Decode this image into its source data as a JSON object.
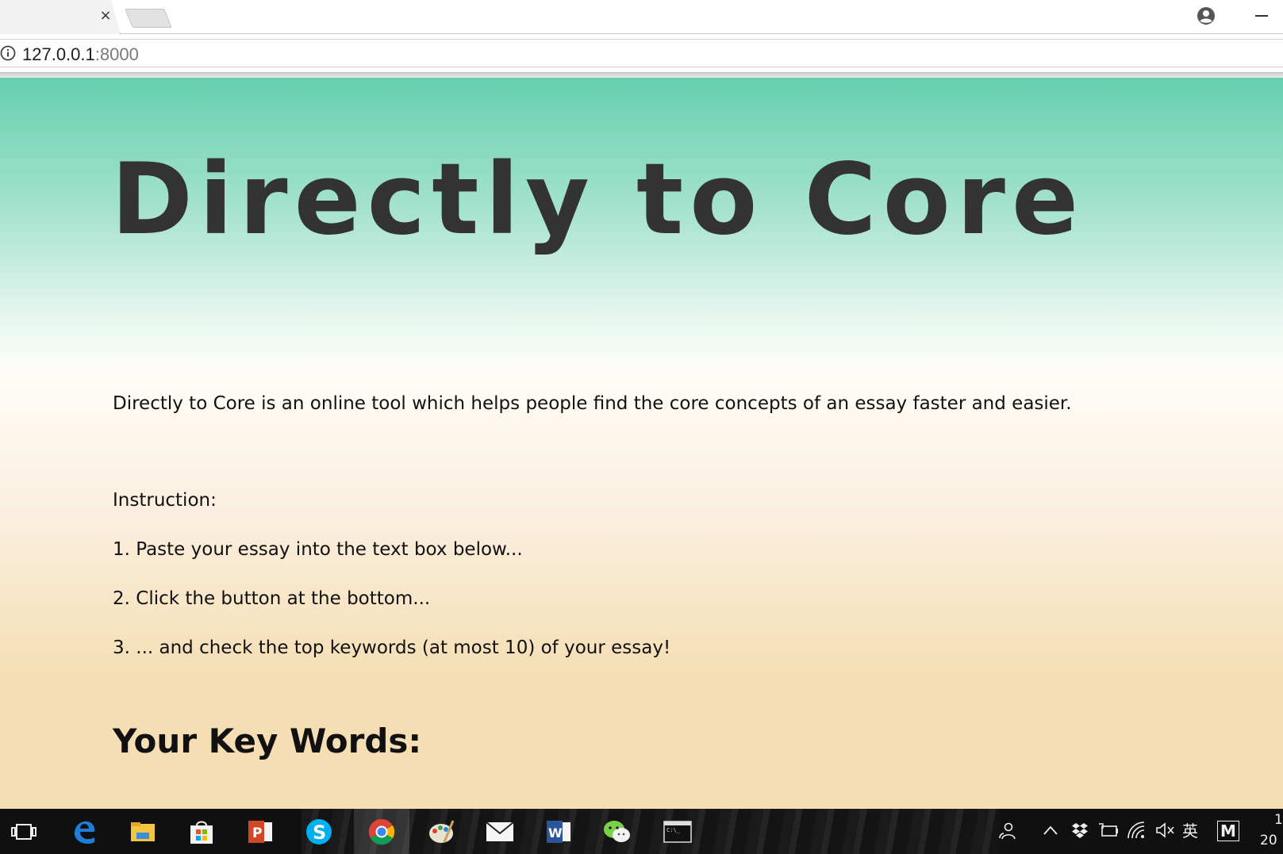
{
  "browser": {
    "tab_close_glyph": "×",
    "url_host": "127.0.0.1",
    "url_port": ":8000"
  },
  "page": {
    "title": "Directly to Core",
    "intro": "Directly to Core is an online tool which helps people find the core concepts of an essay faster and easier.",
    "instructions": [
      "Instruction:",
      "1. Paste your essay into the text box below...",
      "2. Click the button at the bottom...",
      "3. ... and check the top keywords (at most 10) of your essay!"
    ],
    "keywords_heading": "Your Key Words:"
  },
  "taskbar": {
    "apps": [
      "task-view-icon",
      "edge-icon",
      "file-explorer-icon",
      "store-icon",
      "powerpoint-icon",
      "skype-icon",
      "chrome-icon",
      "paint-icon",
      "mail-icon",
      "word-icon",
      "wechat-icon",
      "terminal-icon"
    ],
    "tray": {
      "ime_label": "英",
      "m_label": "M",
      "clock_line1": "1",
      "clock_line2": "20"
    }
  },
  "colors": {
    "page_top": "#65cfad",
    "page_bottom": "#f5deb3",
    "title_text": "#333333",
    "taskbar": "#101010"
  }
}
